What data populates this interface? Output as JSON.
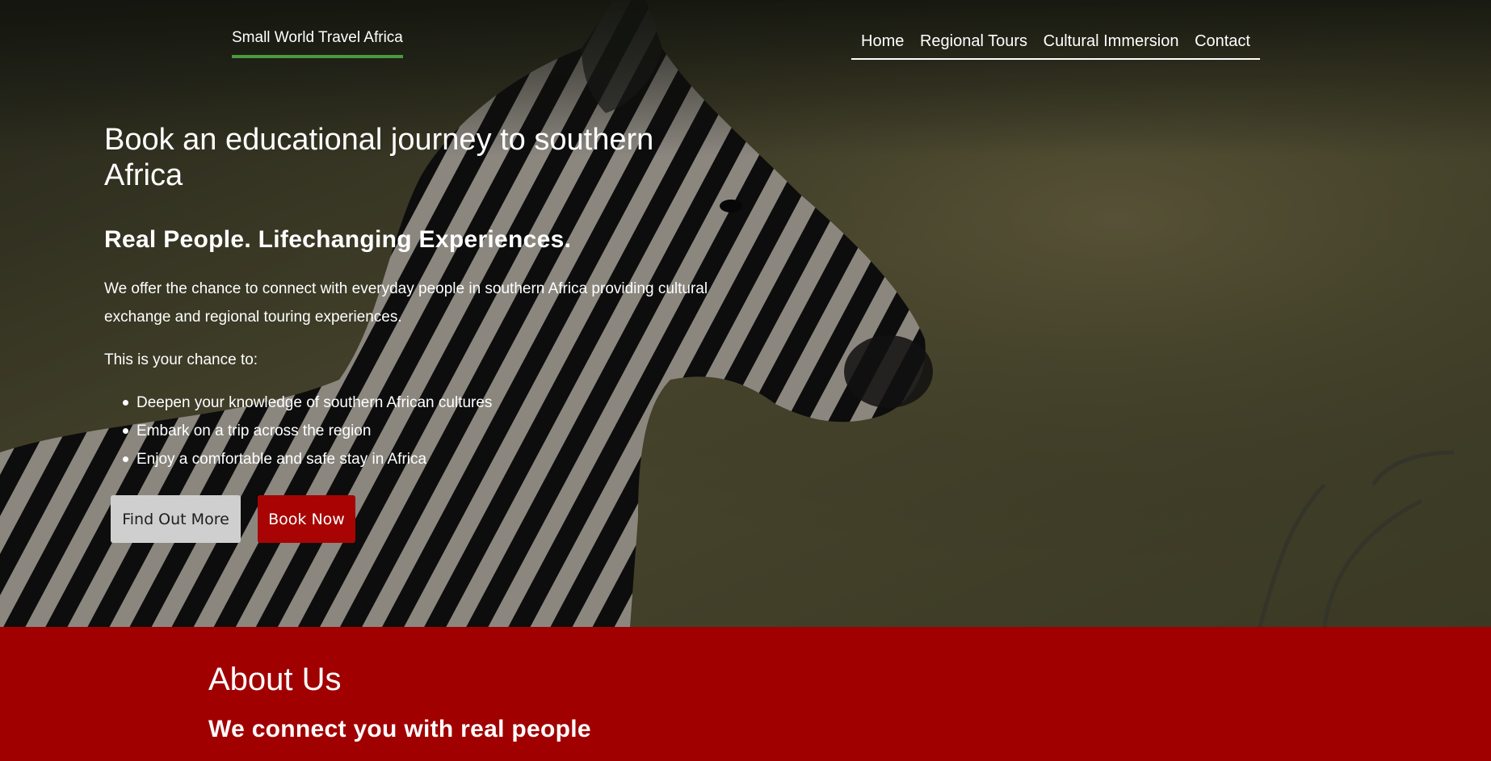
{
  "site": {
    "title": "Small World Travel Africa"
  },
  "nav": {
    "items": [
      {
        "label": "Home"
      },
      {
        "label": "Regional Tours"
      },
      {
        "label": "Cultural Immersion"
      },
      {
        "label": "Contact"
      }
    ]
  },
  "hero": {
    "heading": "Book an educational journey to southern Africa",
    "subheading": "Real People. Lifechanging Experiences.",
    "intro": "We offer the chance to connect with everyday people in southern Africa providing cultural exchange and regional touring experiences.",
    "chance": "This is your chance to:",
    "benefits": [
      "Deepen your knowledge of southern African cultures",
      "Embark on a trip across the region",
      "Enjoy a comfortable and safe stay in Africa"
    ],
    "buttons": {
      "find_out_more": "Find Out More",
      "book_now": "Book Now"
    },
    "background_image": "zebra-photo"
  },
  "about": {
    "title": "About Us",
    "subtitle": "We connect you with real people"
  },
  "colors": {
    "accent_green": "#4a9a3e",
    "brand_red": "#a00000",
    "book_button": "#a80404",
    "secondary_button": "#cfcfcf"
  }
}
